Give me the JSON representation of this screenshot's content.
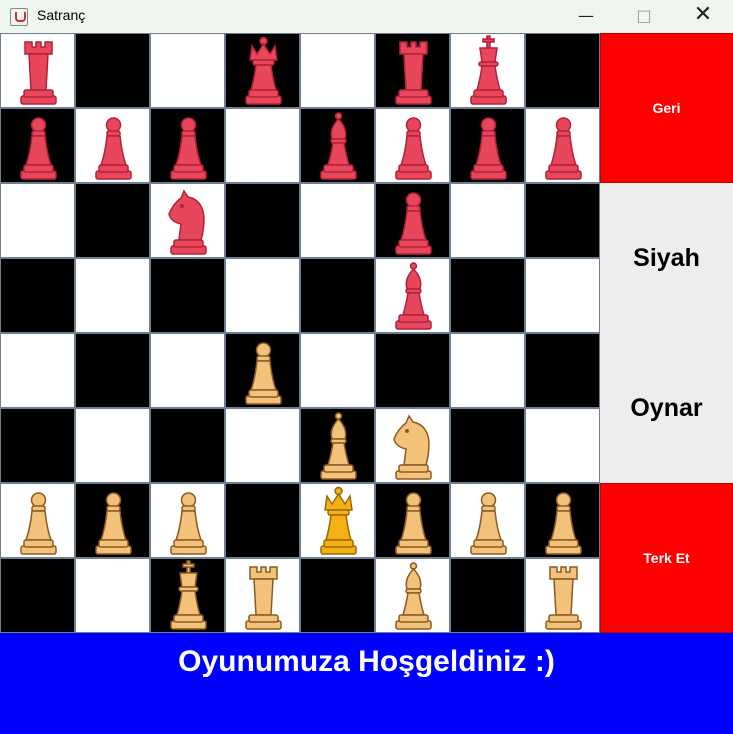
{
  "window": {
    "title": "Satranç"
  },
  "side_panel": {
    "back_label": "Geri",
    "turn_color": "Siyah",
    "turn_action": "Oynar",
    "resign_label": "Terk Et"
  },
  "status_bar": {
    "message": "Oyunumuza Hoşgeldiniz :)"
  },
  "colors": {
    "black_pieces": "#e8465a",
    "white_pieces": "#f3c27a",
    "white_king": "#f5b014",
    "button_red": "#ff0000",
    "status_blue": "#0000ff",
    "dark_square": "#000000",
    "light_square": "#ffffff"
  },
  "board": {
    "rows": [
      [
        {
          "color": "black",
          "piece": "rook"
        },
        null,
        null,
        {
          "color": "black",
          "piece": "queen"
        },
        null,
        {
          "color": "black",
          "piece": "rook"
        },
        {
          "color": "black",
          "piece": "king"
        },
        null
      ],
      [
        {
          "color": "black",
          "piece": "pawn"
        },
        {
          "color": "black",
          "piece": "pawn"
        },
        {
          "color": "black",
          "piece": "pawn"
        },
        null,
        {
          "color": "black",
          "piece": "bishop"
        },
        {
          "color": "black",
          "piece": "pawn"
        },
        {
          "color": "black",
          "piece": "pawn"
        },
        {
          "color": "black",
          "piece": "pawn"
        }
      ],
      [
        null,
        null,
        {
          "color": "black",
          "piece": "knight"
        },
        null,
        null,
        {
          "color": "black",
          "piece": "pawn"
        },
        null,
        null
      ],
      [
        null,
        null,
        null,
        null,
        null,
        {
          "color": "black",
          "piece": "bishop"
        },
        null,
        null
      ],
      [
        null,
        null,
        null,
        {
          "color": "white",
          "piece": "pawn"
        },
        null,
        null,
        null,
        null
      ],
      [
        null,
        null,
        null,
        null,
        {
          "color": "white",
          "piece": "bishop"
        },
        {
          "color": "white",
          "piece": "knight"
        },
        null,
        null
      ],
      [
        {
          "color": "white",
          "piece": "pawn"
        },
        {
          "color": "white",
          "piece": "pawn"
        },
        {
          "color": "white",
          "piece": "pawn"
        },
        null,
        {
          "color": "white",
          "piece": "queen"
        },
        {
          "color": "white",
          "piece": "pawn"
        },
        {
          "color": "white",
          "piece": "pawn"
        },
        {
          "color": "white",
          "piece": "pawn"
        }
      ],
      [
        null,
        null,
        {
          "color": "white",
          "piece": "king"
        },
        {
          "color": "white",
          "piece": "rook"
        },
        null,
        {
          "color": "white",
          "piece": "bishop"
        },
        null,
        {
          "color": "white",
          "piece": "rook"
        }
      ]
    ]
  }
}
